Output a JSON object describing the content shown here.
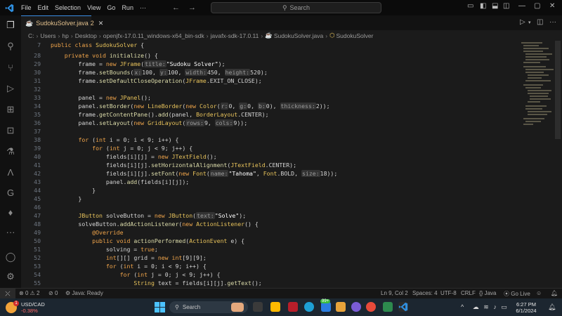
{
  "titlebar": {
    "menus": [
      "File",
      "Edit",
      "Selection",
      "View",
      "Go",
      "Run",
      "···"
    ],
    "search_placeholder": "Search"
  },
  "tab": {
    "filename": "SudokuSolver.java",
    "badge": "2"
  },
  "breadcrumb": [
    "C:",
    "Users",
    "hp",
    "Desktop",
    "openjfx-17.0.11_windows-x64_bin-sdk",
    "javafx-sdk-17.0.11",
    "SudokuSolver.java",
    "SudokuSolver"
  ],
  "gutter": [
    "7",
    "28",
    "29",
    "30",
    "31",
    "32",
    "33",
    "34",
    "35",
    "36",
    "37",
    "38",
    "39",
    "40",
    "41",
    "42",
    "43",
    "44",
    "45",
    "46",
    "47",
    "48",
    "49",
    "50",
    "51",
    "52",
    "53",
    "54",
    "55"
  ],
  "statusbar": {
    "problems_errors": "0",
    "problems_warnings": "2",
    "ports": "0",
    "java_status": "Java: Ready",
    "cursor": "Ln 9, Col 2",
    "spaces": "Spaces: 4",
    "encoding": "UTF-8",
    "eol": "CRLF",
    "language": "Java",
    "golive": "Go Live"
  },
  "taskbar": {
    "ticker": "USD/CAD",
    "change": "-0.38%",
    "search": "Search",
    "badge_count": "99+",
    "time": "6:27 PM",
    "date": "6/1/2024"
  },
  "colors": {
    "accent": "#3a8ee6",
    "keyword": "#f0a44a",
    "type": "#e8c35b",
    "editor_bg": "#1b1b1b"
  }
}
